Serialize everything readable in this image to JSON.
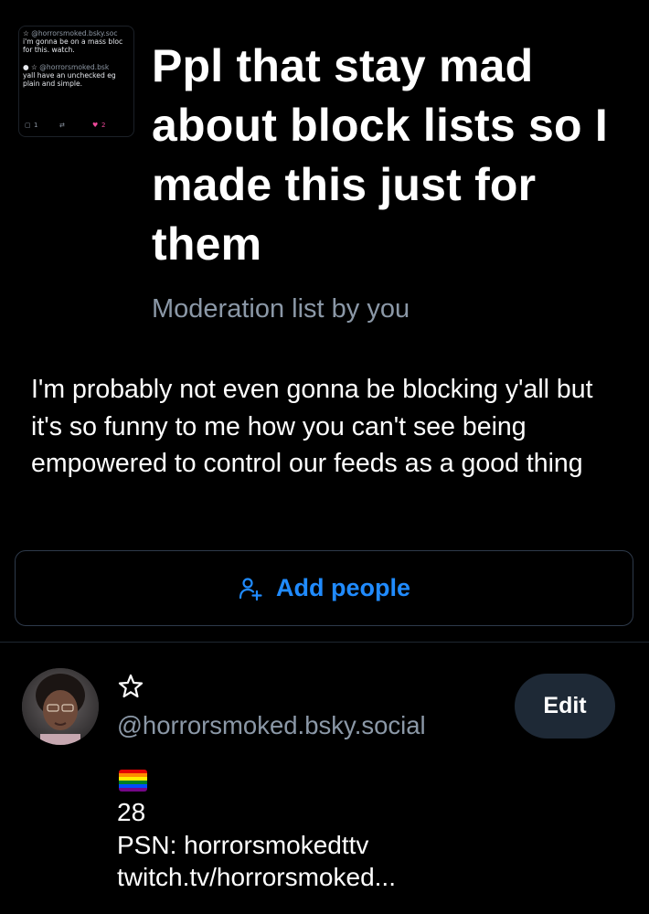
{
  "list": {
    "thumbnail": {
      "post1_handle": "@horrorsmoked.bsky.soc",
      "post1_text_1": "i'm gonna be on a mass bloc",
      "post1_text_2": "for this. watch.",
      "post2_handle": "@horrorsmoked.bsk",
      "post2_text_1": "yall have an unchecked eg",
      "post2_text_2": "plain and simple.",
      "reply_count": "1",
      "like_count": "2"
    },
    "title": "Ppl that stay mad about block lists so I made this just for them",
    "meta": "Moderation list by you",
    "description": "I'm probably not even gonna be blocking y'all but it's so funny to me how you can't see being empowered to control our feeds as a good thing",
    "add_people_label": "Add people"
  },
  "member": {
    "star": "☆",
    "handle": "@horrorsmoked.bsky.social",
    "edit_label": "Edit",
    "bio_lines": [
      "28",
      "PSN: horrorsmokedttv",
      "twitch.tv/horrorsmoked..."
    ]
  },
  "colors": {
    "background": "#000000",
    "accent": "#208bfe",
    "muted_text": "#8b98a7",
    "button_border": "#2e3a4b",
    "edit_button_bg": "#1e2936",
    "like_heart": "#ec4899"
  },
  "icons": {
    "add_people": "person-plus-icon",
    "star": "star-outline-icon",
    "flag": "rainbow-flag-icon",
    "reply": "reply-icon",
    "repost": "repost-icon",
    "like": "heart-icon"
  }
}
